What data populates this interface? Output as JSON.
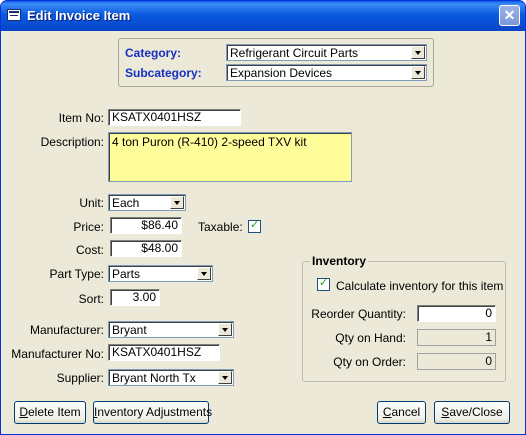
{
  "window": {
    "title": "Edit Invoice Item",
    "close_symbol": "✕"
  },
  "category": {
    "label": "Category:",
    "value": "Refrigerant Circuit Parts"
  },
  "subcategory": {
    "label": "Subcategory:",
    "value": "Expansion Devices"
  },
  "item_no": {
    "label": "Item No:",
    "value": "KSATX0401HSZ"
  },
  "description": {
    "label": "Description:",
    "value": "4 ton Puron (R-410) 2-speed TXV kit"
  },
  "unit": {
    "label": "Unit:",
    "value": "Each"
  },
  "price": {
    "label": "Price:",
    "value": "$86.40"
  },
  "taxable": {
    "label": "Taxable:",
    "checked": true
  },
  "cost": {
    "label": "Cost:",
    "value": "$48.00"
  },
  "part_type": {
    "label": "Part Type:",
    "value": "Parts"
  },
  "sort": {
    "label": "Sort:",
    "value": "3.00"
  },
  "manufacturer": {
    "label": "Manufacturer:",
    "value": "Bryant"
  },
  "manufacturer_no": {
    "label": "Manufacturer No:",
    "value": "KSATX0401HSZ"
  },
  "supplier": {
    "label": "Supplier:",
    "value": "Bryant North Tx"
  },
  "inventory": {
    "title": "Inventory",
    "calculate_label": "Calculate inventory for this item",
    "calculate_checked": true,
    "reorder_label": "Reorder Quantity:",
    "reorder_value": "0",
    "on_hand_label": "Qty on Hand:",
    "on_hand_value": "1",
    "on_order_label": "Qty on Order:",
    "on_order_value": "0"
  },
  "buttons": {
    "delete_label_u": "D",
    "delete_label_rest": "elete Item",
    "inventory_label_u": "I",
    "inventory_label_rest": "nventory Adjustments",
    "cancel_label_u": "C",
    "cancel_label_rest": "ancel",
    "save_label_u": "S",
    "save_label_rest": "ave/Close"
  }
}
